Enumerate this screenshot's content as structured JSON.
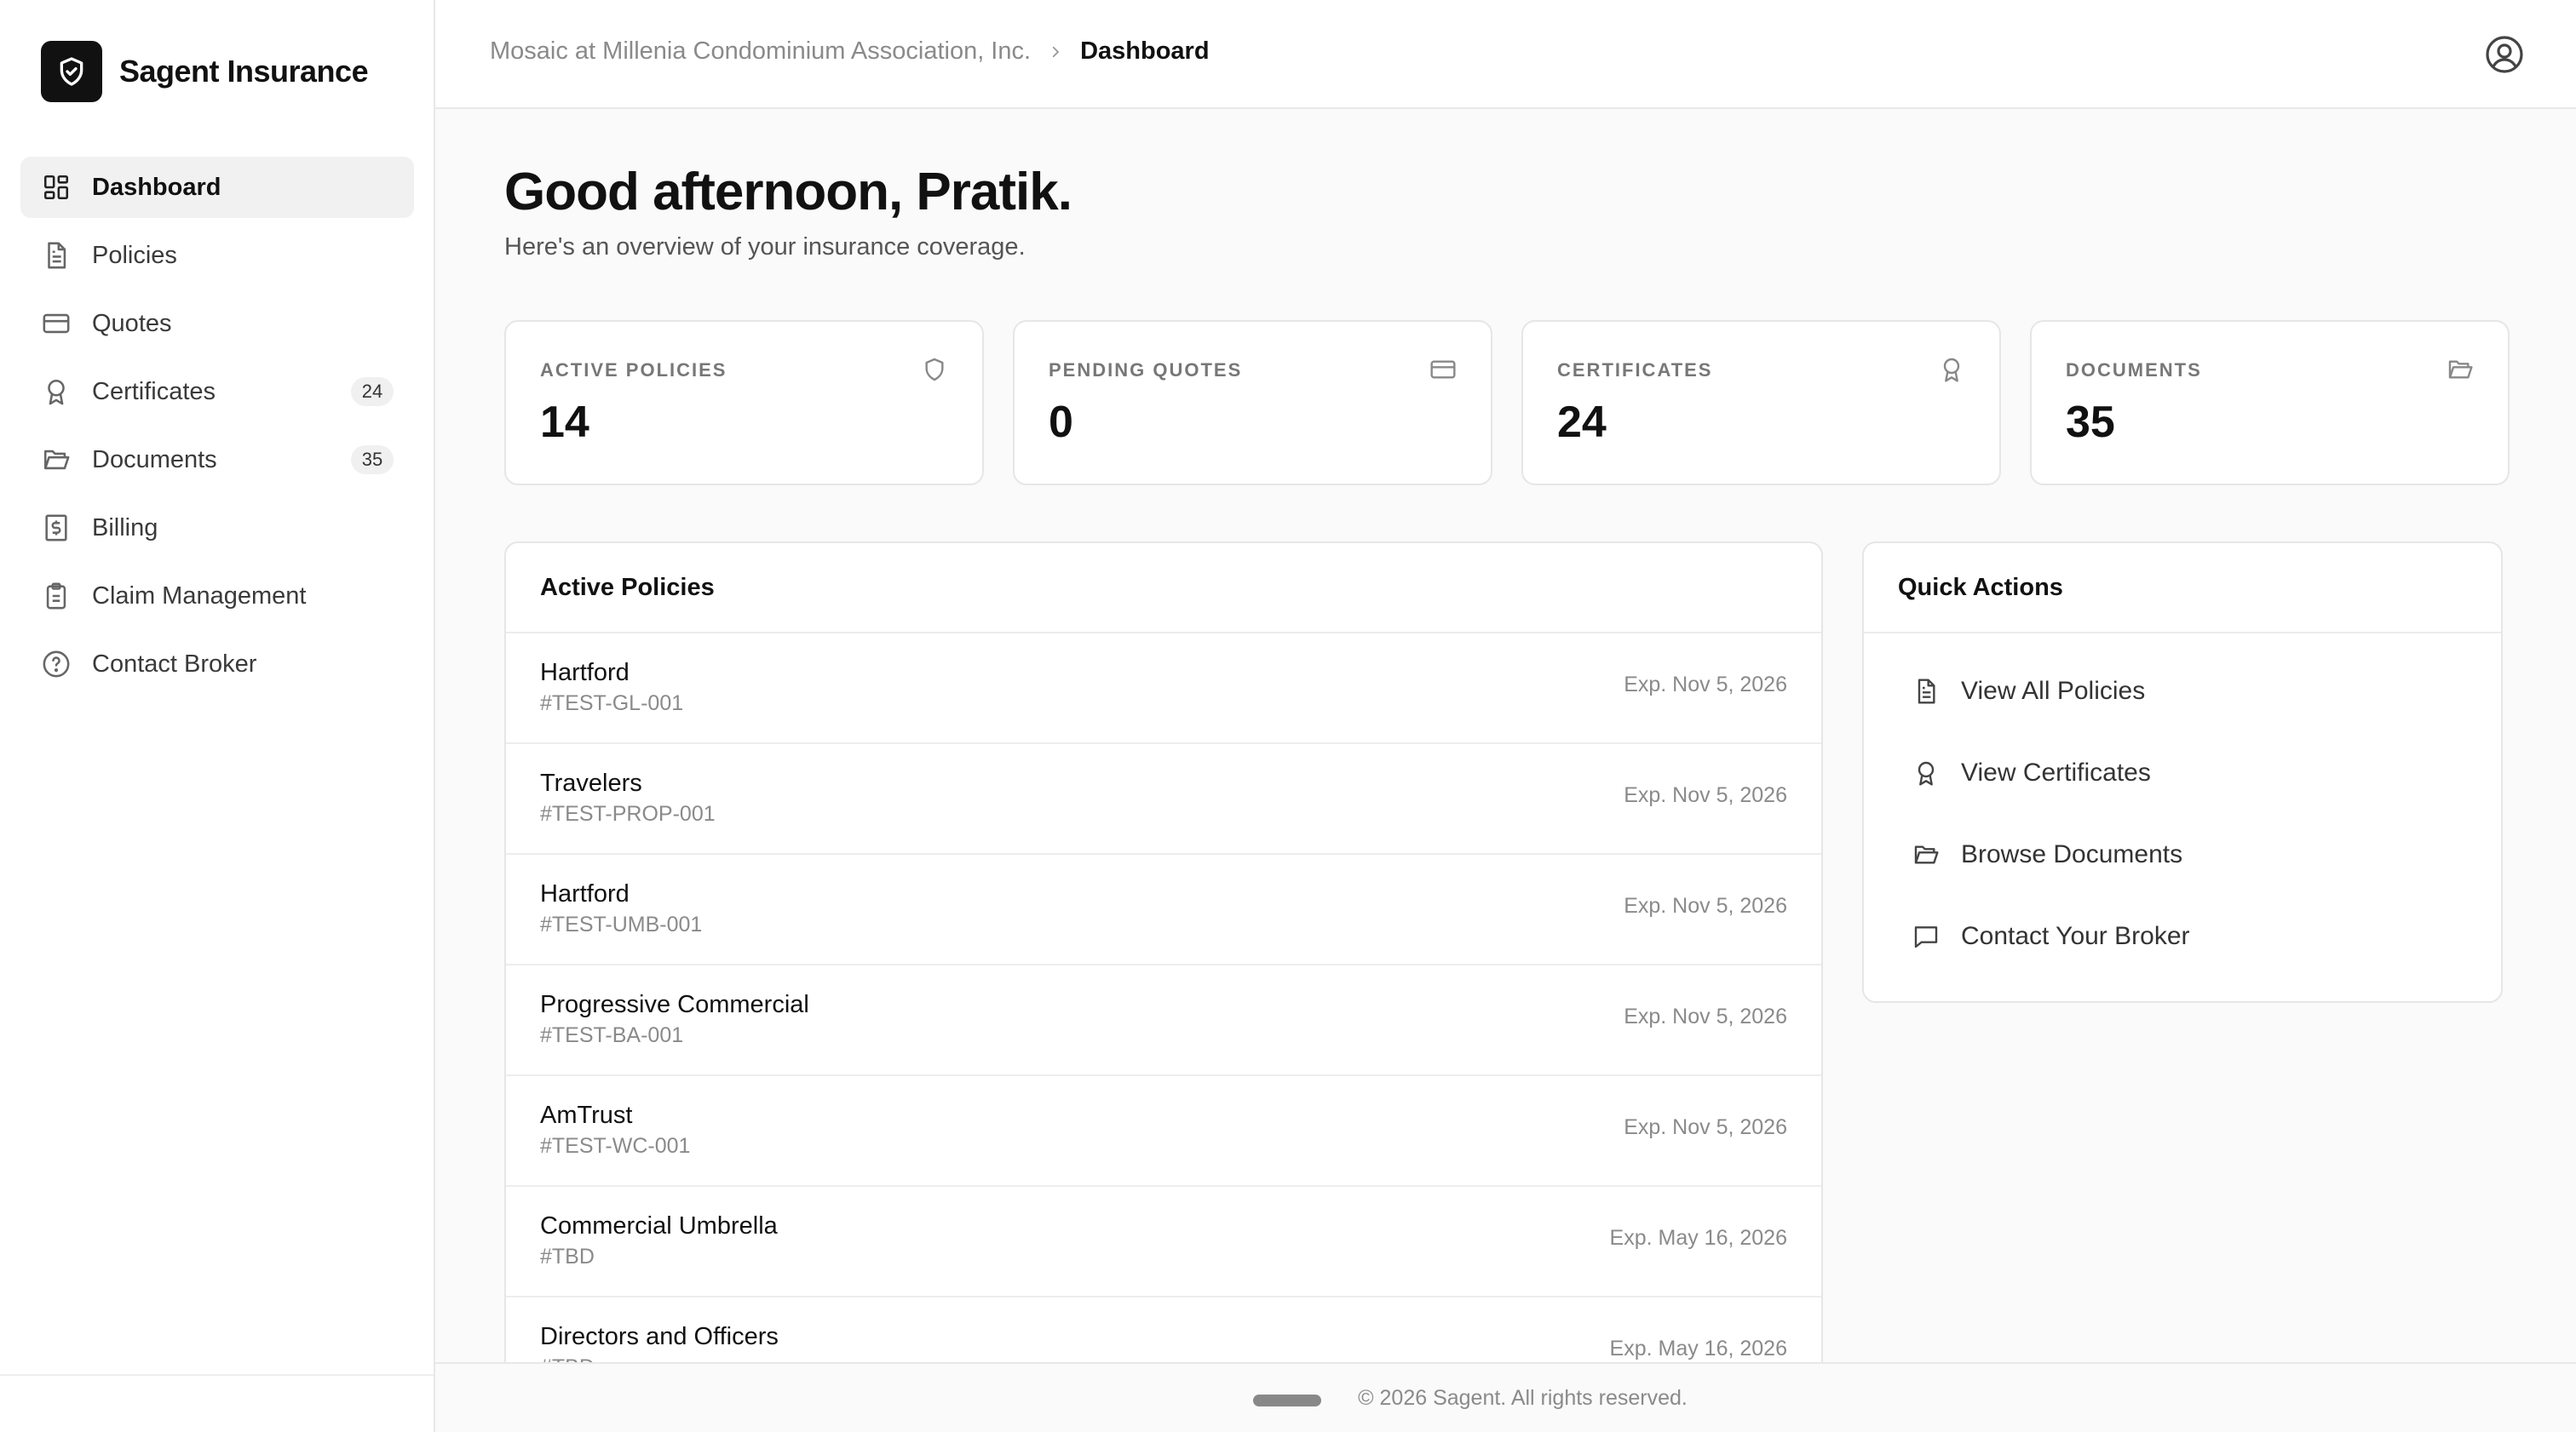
{
  "brand": {
    "name": "Sagent Insurance",
    "logo_icon": "shield-check-icon"
  },
  "sidebar": {
    "items": [
      {
        "label": "Dashboard",
        "icon": "dashboard-grid-icon",
        "active": true,
        "badge": ""
      },
      {
        "label": "Policies",
        "icon": "document-icon",
        "active": false,
        "badge": ""
      },
      {
        "label": "Quotes",
        "icon": "credit-card-icon",
        "active": false,
        "badge": ""
      },
      {
        "label": "Certificates",
        "icon": "award-icon",
        "active": false,
        "badge": "24"
      },
      {
        "label": "Documents",
        "icon": "folder-open-icon",
        "active": false,
        "badge": "35"
      },
      {
        "label": "Billing",
        "icon": "dollar-receipt-icon",
        "active": false,
        "badge": ""
      },
      {
        "label": "Claim Management",
        "icon": "clipboard-icon",
        "active": false,
        "badge": ""
      },
      {
        "label": "Contact Broker",
        "icon": "help-circle-icon",
        "active": false,
        "badge": ""
      }
    ]
  },
  "header": {
    "breadcrumb_parent": "Mosaic at Millenia Condominium Association, Inc.",
    "breadcrumb_current": "Dashboard",
    "user_icon": "user-circle-icon"
  },
  "main": {
    "greeting": "Good afternoon, Pratik.",
    "subtitle": "Here's an overview of your insurance coverage.",
    "stats": [
      {
        "label": "ACTIVE POLICIES",
        "value": "14",
        "icon": "shield-icon"
      },
      {
        "label": "PENDING QUOTES",
        "value": "0",
        "icon": "credit-card-icon"
      },
      {
        "label": "CERTIFICATES",
        "value": "24",
        "icon": "award-icon"
      },
      {
        "label": "DOCUMENTS",
        "value": "35",
        "icon": "folder-open-icon"
      }
    ],
    "policies": {
      "title": "Active Policies",
      "rows": [
        {
          "name": "Hartford",
          "id": "#TEST-GL-001",
          "exp": "Exp. Nov 5, 2026"
        },
        {
          "name": "Travelers",
          "id": "#TEST-PROP-001",
          "exp": "Exp. Nov 5, 2026"
        },
        {
          "name": "Hartford",
          "id": "#TEST-UMB-001",
          "exp": "Exp. Nov 5, 2026"
        },
        {
          "name": "Progressive Commercial",
          "id": "#TEST-BA-001",
          "exp": "Exp. Nov 5, 2026"
        },
        {
          "name": "AmTrust",
          "id": "#TEST-WC-001",
          "exp": "Exp. Nov 5, 2026"
        },
        {
          "name": "Commercial Umbrella",
          "id": "#TBD",
          "exp": "Exp. May 16, 2026"
        },
        {
          "name": "Directors and Officers",
          "id": "#TBD",
          "exp": "Exp. May 16, 2026"
        }
      ]
    },
    "quick_actions": {
      "title": "Quick Actions",
      "items": [
        {
          "label": "View All Policies",
          "icon": "document-icon"
        },
        {
          "label": "View Certificates",
          "icon": "award-icon"
        },
        {
          "label": "Browse Documents",
          "icon": "folder-open-icon"
        },
        {
          "label": "Contact Your Broker",
          "icon": "message-square-icon"
        }
      ]
    }
  },
  "footer": {
    "text": "© 2026 Sagent. All rights reserved."
  }
}
